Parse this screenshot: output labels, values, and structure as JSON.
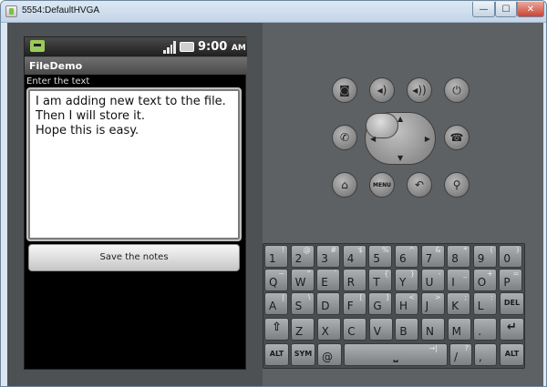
{
  "window": {
    "title": "5554:DefaultHVGA",
    "min_glyph": "—",
    "max_glyph": "☐",
    "close_glyph": "✕"
  },
  "phone": {
    "statusbar": {
      "time": "9:00",
      "ampm": "AM"
    },
    "app_title": "FileDemo",
    "input_label": "Enter the text",
    "textarea_value": "I am adding new text to the file.\nThen I will store it.\nHope this is easy.",
    "save_button": "Save the notes"
  },
  "controls": {
    "top_row": [
      {
        "name": "camera-button",
        "glyph": "◙"
      },
      {
        "name": "volume-down-button",
        "glyph": "◂)"
      },
      {
        "name": "volume-up-button",
        "glyph": "◂))"
      },
      {
        "name": "power-button",
        "glyph": "⏻"
      }
    ],
    "call_glyph": "✆",
    "end_call_glyph": "☎",
    "dpad": {
      "up": "▲",
      "down": "▼",
      "left": "◀",
      "right": "▶"
    },
    "bottom_row": [
      {
        "name": "home-button",
        "glyph": "⌂"
      },
      {
        "name": "menu-button",
        "glyph": "MENU"
      },
      {
        "name": "back-button",
        "glyph": "↶"
      },
      {
        "name": "search-button",
        "glyph": "⚲"
      }
    ]
  },
  "keyboard": {
    "row1": [
      [
        "1",
        "!"
      ],
      [
        "2",
        "@"
      ],
      [
        "3",
        "#"
      ],
      [
        "4",
        "$"
      ],
      [
        "5",
        "%"
      ],
      [
        "6",
        "^"
      ],
      [
        "7",
        "&"
      ],
      [
        "8",
        "*"
      ],
      [
        "9",
        "("
      ],
      [
        "0",
        ")"
      ]
    ],
    "row2": [
      [
        "Q",
        "~"
      ],
      [
        "W",
        "\""
      ],
      [
        "E",
        "´"
      ],
      [
        "R",
        ""
      ],
      [
        "T",
        "{"
      ],
      [
        "Y",
        "}"
      ],
      [
        "U",
        "-"
      ],
      [
        "I",
        "_"
      ],
      [
        "O",
        "+"
      ],
      [
        "P",
        "="
      ]
    ],
    "row3": [
      [
        "A",
        "|"
      ],
      [
        "S",
        "\\"
      ],
      [
        "D",
        ""
      ],
      [
        "F",
        "["
      ],
      [
        "G",
        "]"
      ],
      [
        "H",
        "<"
      ],
      [
        "J",
        ">"
      ],
      [
        "K",
        ";"
      ],
      [
        "L",
        ":"
      ]
    ],
    "row4": [
      [
        "Z",
        ""
      ],
      [
        "X",
        ""
      ],
      [
        "C",
        ""
      ],
      [
        "V",
        ""
      ],
      [
        "B",
        ""
      ],
      [
        "N",
        ""
      ],
      [
        "M",
        ""
      ],
      [
        ".",
        ""
      ]
    ],
    "del_label": "DEL",
    "shift_glyph": "⇧",
    "enter_glyph": "↵",
    "alt_label": "ALT",
    "sym_label": "SYM",
    "at_key": "@",
    "space_glyph": "⎵",
    "tab_glyph": "→|",
    "slash_key": "/",
    "slash_alt": "?",
    "comma_key": ",",
    "comma_alt": ""
  }
}
